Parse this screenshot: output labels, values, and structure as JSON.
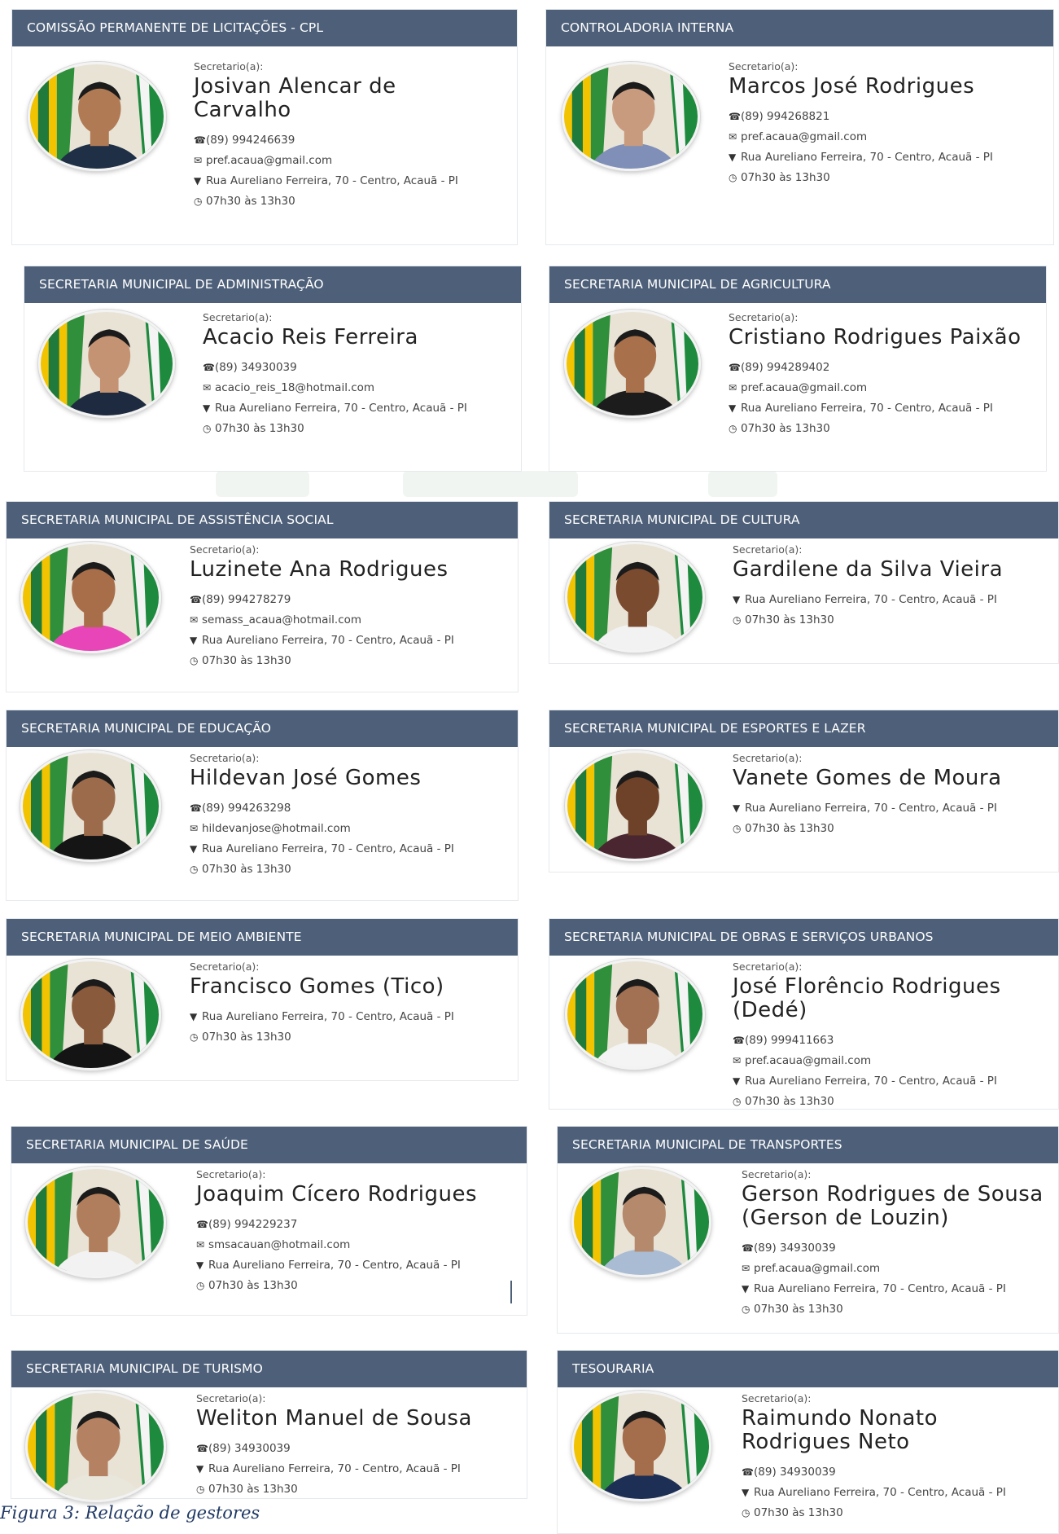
{
  "role_label": "Secretario(a):",
  "caption": "Figura 3: Relação de gestores",
  "cards": [
    {
      "header": "COMISSÃO PERMANENTE DE LICITAÇÕES - CPL",
      "name": "Josivan Alencar de Carvalho",
      "phone": "(89) 994246639",
      "email": "pref.acaua@gmail.com",
      "address": "Rua Aureliano Ferreira, 70 - Centro, Acauã - PI",
      "hours": "07h30 às 13h30",
      "shirt": "#1f2f46",
      "skin": "#b07a55"
    },
    {
      "header": "CONTROLADORIA INTERNA",
      "name": "Marcos José Rodrigues",
      "phone": "(89) 994268821",
      "email": "pref.acaua@gmail.com",
      "address": "Rua Aureliano Ferreira, 70 - Centro, Acauã - PI",
      "hours": "07h30 às 13h30",
      "shirt": "#7f8fb8",
      "skin": "#c89b7e"
    },
    {
      "header": "SECRETARIA MUNICIPAL DE ADMINISTRAÇÃO",
      "name": "Acacio Reis Ferreira",
      "phone": "(89) 34930039",
      "email": "acacio_reis_18@hotmail.com",
      "address": "Rua Aureliano Ferreira, 70 - Centro, Acauã - PI",
      "hours": "07h30 às 13h30",
      "shirt": "#1e2a40",
      "skin": "#c49373"
    },
    {
      "header": "SECRETARIA MUNICIPAL DE AGRICULTURA",
      "name": "Cristiano Rodrigues Paixão",
      "phone": "(89) 994289402",
      "email": "pref.acaua@gmail.com",
      "address": "Rua Aureliano Ferreira, 70 - Centro, Acauã - PI",
      "hours": "07h30 às 13h30",
      "shirt": "#1c1c1c",
      "skin": "#a8704b"
    },
    {
      "header": "SECRETARIA MUNICIPAL DE ASSISTÊNCIA SOCIAL",
      "name": "Luzinete Ana Rodrigues",
      "phone": "(89) 994278279",
      "email": "semass_acaua@hotmail.com",
      "address": "Rua Aureliano Ferreira, 70 - Centro, Acauã - PI",
      "hours": "07h30 às 13h30",
      "shirt": "#e846b8",
      "skin": "#a86e4a"
    },
    {
      "header": "SECRETARIA MUNICIPAL DE CULTURA",
      "name": "Gardilene da Silva Vieira",
      "address": "Rua Aureliano Ferreira, 70 - Centro, Acauã - PI",
      "hours": "07h30 às 13h30",
      "shirt": "#f2f2f2",
      "skin": "#7b4b30"
    },
    {
      "header": "SECRETARIA MUNICIPAL DE EDUCAÇÃO",
      "name": "Hildevan José Gomes",
      "phone": "(89) 994263298",
      "email": "hildevanjose@hotmail.com",
      "address": "Rua Aureliano Ferreira, 70 - Centro, Acauã - PI",
      "hours": "07h30 às 13h30",
      "shirt": "#151515",
      "skin": "#9c6b4b"
    },
    {
      "header": "SECRETARIA MUNICIPAL DE ESPORTES E LAZER",
      "name": "Vanete Gomes de Moura",
      "address": "Rua Aureliano Ferreira, 70 - Centro, Acauã - PI",
      "hours": "07h30 às 13h30",
      "shirt": "#4a2630",
      "skin": "#6e4129"
    },
    {
      "header": "SECRETARIA MUNICIPAL DE MEIO AMBIENTE",
      "name": "Francisco Gomes (Tico)",
      "address": "Rua Aureliano Ferreira, 70 - Centro, Acauã - PI",
      "hours": "07h30 às 13h30",
      "shirt": "#141414",
      "skin": "#8a5a3c"
    },
    {
      "header": "SECRETARIA MUNICIPAL DE OBRAS E SERVIÇOS URBANOS",
      "name": "José Florêncio Rodrigues (Dedé)",
      "phone": "(89) 999411663",
      "email": "pref.acaua@gmail.com",
      "address": "Rua Aureliano Ferreira, 70 - Centro, Acauã - PI",
      "hours": "07h30 às 13h30",
      "shirt": "#f4f4f4",
      "skin": "#a27052"
    },
    {
      "header": "SECRETARIA MUNICIPAL DE SAÚDE",
      "name": "Joaquim Cícero Rodrigues",
      "phone": "(89) 994229237",
      "email": "smsacauan@hotmail.com",
      "address": "Rua Aureliano Ferreira, 70 - Centro, Acauã - PI",
      "hours": "07h30 às 13h30",
      "shirt": "#f2f2f2",
      "skin": "#b07e5c"
    },
    {
      "header": "SECRETARIA MUNICIPAL DE TRANSPORTES",
      "name": "Gerson Rodrigues de Sousa (Gerson de Louzin)",
      "phone": "(89) 34930039",
      "email": "pref.acaua@gmail.com",
      "address": "Rua Aureliano Ferreira, 70 - Centro, Acauã - PI",
      "hours": "07h30 às 13h30",
      "shirt": "#a9bcd4",
      "skin": "#b58a6c"
    },
    {
      "header": "SECRETARIA MUNICIPAL DE TURISMO",
      "name": "Weliton Manuel de Sousa",
      "phone": "(89) 34930039",
      "address": "Rua Aureliano Ferreira, 70 - Centro, Acauã - PI",
      "hours": "07h30 às 13h30",
      "shirt": "#e9e6dc",
      "skin": "#b58163"
    },
    {
      "header": "TESOURARIA",
      "name": "Raimundo Nonato Rodrigues Neto",
      "phone": "(89) 34930039",
      "address": "Rua Aureliano Ferreira, 70 - Centro, Acauã - PI",
      "hours": "07h30 às 13h30",
      "shirt": "#1d2f55",
      "skin": "#a46d4b"
    }
  ]
}
